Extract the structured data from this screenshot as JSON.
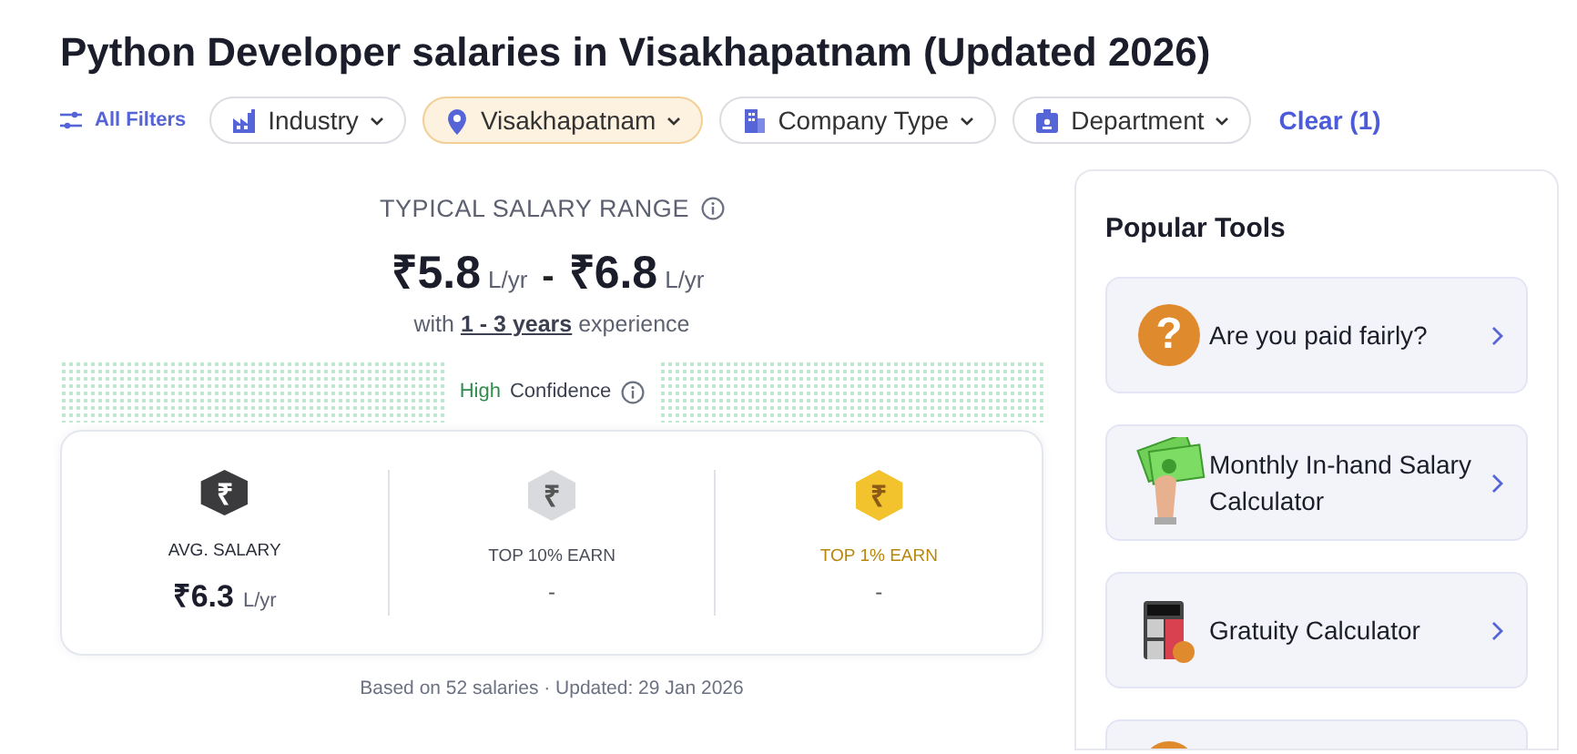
{
  "title": "Python Developer salaries in Visakhapatnam (Updated 2026)",
  "filters": {
    "all_label": "All Filters",
    "items": [
      {
        "label": "Industry",
        "kind": "factory",
        "selected": false
      },
      {
        "label": "Visakhapatnam",
        "kind": "pin",
        "selected": true
      },
      {
        "label": "Company Type",
        "kind": "building",
        "selected": false
      },
      {
        "label": "Department",
        "kind": "badge",
        "selected": false
      }
    ],
    "clear": "Clear (1)"
  },
  "range": {
    "heading": "TYPICAL SALARY RANGE",
    "low_symbol": "₹",
    "low": "5.8",
    "low_unit": "L/yr",
    "sep": "-",
    "high_symbol": "₹",
    "high": "6.8",
    "high_unit": "L/yr",
    "experience_pre": "with",
    "experience_link": "1 - 3 years",
    "experience_post": "experience"
  },
  "confidence": {
    "level_text": "High",
    "label": "Confidence"
  },
  "stats": [
    {
      "kind": "dark",
      "symbol": "₹",
      "label": "AVG. SALARY",
      "value_symbol": "₹",
      "value": "6.3",
      "unit": "L/yr"
    },
    {
      "kind": "silver",
      "symbol": "₹",
      "label": "TOP 10% EARN",
      "value": "-"
    },
    {
      "kind": "gold",
      "symbol": "₹",
      "label": "TOP 1% EARN",
      "value": "-"
    }
  ],
  "footnote": "Based on 52 salaries · Updated: 29 Jan 2026",
  "tools": {
    "heading": "Popular Tools",
    "items": [
      {
        "kind": "question",
        "symbol": "?",
        "label": "Are you paid fairly?"
      },
      {
        "kind": "cash",
        "label": "Monthly In-hand Salary Calculator"
      },
      {
        "kind": "calculator",
        "label": "Gratuity Calculator"
      },
      {
        "kind": "coin"
      }
    ]
  }
}
